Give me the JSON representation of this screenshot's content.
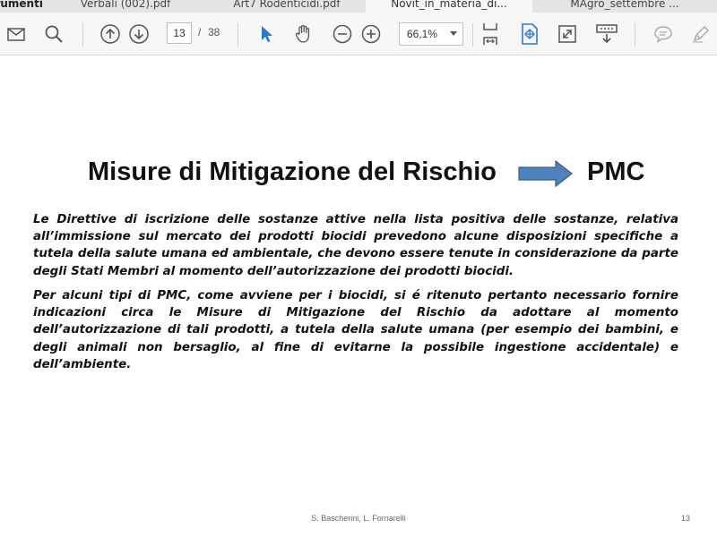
{
  "tabs": [
    {
      "label": "Verbali (002).pdf",
      "active": false
    },
    {
      "label": "Art7 Rodenticidi.pdf",
      "active": false
    },
    {
      "label": "Novit_in_materia_di...",
      "active": true
    },
    {
      "label": "MAgro_settembre ...",
      "active": false
    }
  ],
  "toolbar": {
    "page_current": "13",
    "page_separator": "/",
    "page_total": "38",
    "zoom": "66,1%"
  },
  "icons": {
    "email": "envelope-icon",
    "search": "search-icon",
    "prev_page": "arrow-up-circle-icon",
    "next_page": "arrow-down-circle-icon",
    "select": "cursor-arrow-icon",
    "hand": "hand-icon",
    "zoom_out": "zoom-out-icon",
    "zoom_in": "zoom-in-icon",
    "fit_width": "fit-width-icon",
    "fit_page": "fit-page-icon",
    "full_screen": "full-screen-icon",
    "scrolling": "scroll-mode-icon",
    "comment": "comment-icon",
    "highlight": "pen-icon"
  },
  "colors": {
    "accent": "#2b78d0",
    "arrow_fill": "#4f81bd",
    "arrow_stroke": "#385d8a"
  },
  "slide": {
    "title": "Misure di Mitigazione del Rischio",
    "title_right": "PMC",
    "paragraphs": [
      "Le Direttive di iscrizione delle sostanze attive nella lista positiva delle sostanze, relativa all’immissione sul mercato dei prodotti biocidi prevedono alcune disposizioni specifiche a tutela della salute umana ed ambientale, che devono essere tenute in considerazione da parte degli Stati Membri al momento dell’autorizzazione dei prodotti biocidi.",
      "Per alcuni tipi di PMC, come avviene per i biocidi, si é ritenuto pertanto necessario fornire indicazioni circa le Misure di Mitigazione del Rischio da adottare al momento dell’autorizzazione di tali prodotti, a tutela della salute umana (per esempio dei bambini, e degli animali non bersaglio, al fine di evitarne la possibile ingestione accidentale) e dell’ambiente."
    ],
    "footer_author": "S. Bascherini, L. Fornarelli",
    "footer_page": "13"
  }
}
